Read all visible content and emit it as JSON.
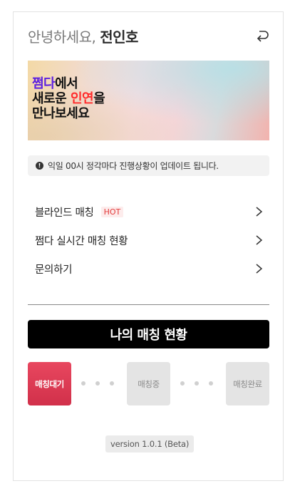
{
  "header": {
    "greeting": "안녕하세요,",
    "user_name": "전인호",
    "logout_icon": "logout-arrow-icon"
  },
  "banner": {
    "line1_brand": "쩜다",
    "line1_rest": "에서",
    "line2_pre": "새로운 ",
    "line2_highlight": "인연",
    "line2_post": "을",
    "line3": "만나보세요",
    "colors": {
      "brand": "#5b1fe0",
      "highlight": "#ff2a2a"
    }
  },
  "notice": {
    "icon": "exclamation-circle-icon",
    "text": "익일 00시 정각마다 진행상황이 업데이트 됩니다."
  },
  "menu": {
    "items": [
      {
        "label": "블라인드 매칭",
        "badge": "HOT"
      },
      {
        "label": "쩜다 실시간 매칭 현황"
      },
      {
        "label": "문의하기"
      }
    ]
  },
  "status_button": {
    "label": "나의 매칭 현황"
  },
  "steps": {
    "items": [
      {
        "label": "매칭대기",
        "state": "active"
      },
      {
        "label": "매칭중",
        "state": "inactive"
      },
      {
        "label": "매칭완료",
        "state": "inactive"
      }
    ],
    "colors": {
      "active": "#d9374f",
      "inactive": "#e4e4e4"
    }
  },
  "footer": {
    "version": "version 1.0.1 (Beta)"
  }
}
